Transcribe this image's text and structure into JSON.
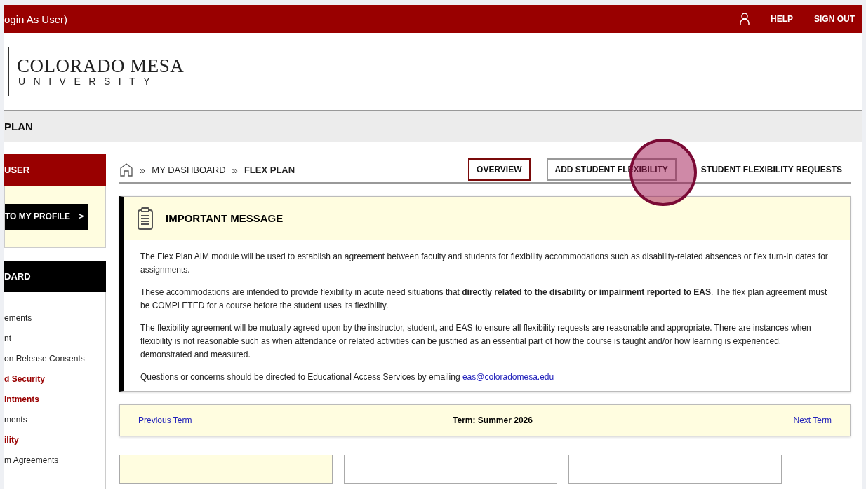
{
  "topbar": {
    "title": "ogin As User)",
    "links": [
      "HELP",
      "SIGN OUT"
    ]
  },
  "logo": {
    "name": "COLORADO MESA",
    "subtitle": "UNIVERSITY"
  },
  "page_title": "PLAN",
  "sidebar": {
    "user_header": "USER",
    "profile_button": "TO MY PROFILE",
    "profile_caret": ">",
    "dashboard_header": "DARD",
    "items": [
      {
        "label": "ements",
        "emphasized": false
      },
      {
        "label": "nt",
        "emphasized": false
      },
      {
        "label": "on Release Consents",
        "emphasized": false
      },
      {
        "label": "d Security",
        "emphasized": true
      },
      {
        "label": "intments",
        "emphasized": true
      },
      {
        "label": "ments",
        "emphasized": false
      },
      {
        "label": "ility",
        "emphasized": true
      },
      {
        "label": "m Agreements",
        "emphasized": false
      }
    ]
  },
  "breadcrumb": {
    "separator": "»",
    "items": [
      "MY DASHBOARD",
      "FLEX PLAN"
    ]
  },
  "tabs": [
    {
      "label": "OVERVIEW",
      "selected": true,
      "bordered": true
    },
    {
      "label": "ADD STUDENT FLEXIBILITY",
      "selected": false,
      "bordered": true
    },
    {
      "label": "STUDENT FLEXIBILITY REQUESTS",
      "selected": false,
      "bordered": false
    }
  ],
  "message": {
    "title": "IMPORTANT MESSAGE",
    "paragraphs": [
      "The Flex Plan AIM module will be used to establish an agreement between faculty and students for flexibility accommodations such as disability-related absences or flex turn-in dates for assignments.",
      "These accommodations are intended to provide flexibility in acute need situations that **directly related to the disability or impairment reported to EAS**. The flex plan agreement must be COMPLETED for a course before the student uses its flexibility.",
      "The flexibility agreement will be mutually agreed upon by the instructor, student, and EAS to ensure all flexibility requests are reasonable and appropriate. There are instances when flexibility is not reasonable such as when attendance or related activities can be justified as an essential part of how the course is taught and/or how learning is experienced, demonstrated and measured."
    ],
    "contact": "Questions or concerns should be directed to Educational Access Services by emailing",
    "email": "eas@coloradomesa.edu"
  },
  "term_bar": {
    "previous": "Previous Term",
    "term": "Term: Summer 2026",
    "next": "Next Term"
  },
  "cards": [
    {
      "highlighted": true
    },
    {
      "highlighted": false
    },
    {
      "highlighted": false
    }
  ]
}
